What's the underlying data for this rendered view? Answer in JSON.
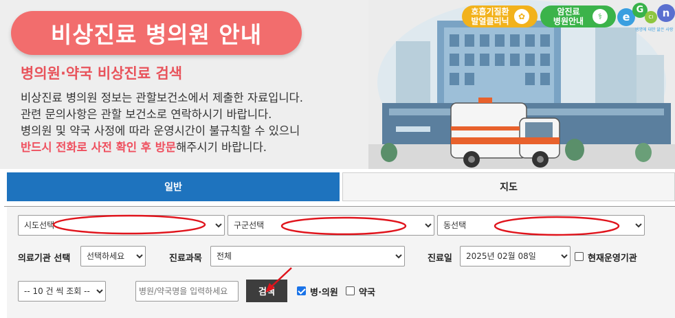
{
  "hero": {
    "title": "비상진료 병의원 안내",
    "subtitle": "병의원·약국 비상진료 검색",
    "desc_line1": "비상진료 병의원 정보는 관할보건소에서 제출한 자료입니다.",
    "desc_line2": "관련 문의사항은 관할 보건소로 연락하시기 바랍니다.",
    "desc_line3": "병의원 및 약국 사정에 따라 운영시간이 불규칙할 수 있으니",
    "desc_line4_highlight": "반드시 전화로 사전 확인 후 방문",
    "desc_line4_rest": "해주시기 바랍니다."
  },
  "badges": {
    "respiratory_line1": "호흡기질환",
    "respiratory_line2": "발열클리닉",
    "cancer_line1": "암진료",
    "cancer_line2": "병원안내"
  },
  "logo": {
    "e": "e",
    "g": "G",
    "ci": "CI",
    "n": "n",
    "tagline": "생명에 대한 앎은 사랑"
  },
  "tabs": {
    "general": "일반",
    "map": "지도"
  },
  "filters": {
    "sido": "시도선택",
    "gugun": "구군선택",
    "dong": "동선택",
    "institution_label": "의료기관 선택",
    "institution_value": "선택하세요",
    "dept_label": "진료과목",
    "dept_value": "전체",
    "date_label": "진료일",
    "date_value": "2025년 02월 08일",
    "operating_label": "현재운영기관",
    "page_size": "-- 10 건 씩 조회 --",
    "name_placeholder": "병원/약국명을 입력하세요",
    "search_button": "검색",
    "hospital_label": "병·의원",
    "pharmacy_label": "약국"
  },
  "colors": {
    "title_pill": "#f26d6d",
    "accent_blue": "#1e73be",
    "highlight_red": "#ef4f5e",
    "annotation_red": "#e0141c"
  },
  "checks": {
    "operating": false,
    "hospital": true,
    "pharmacy": false
  }
}
